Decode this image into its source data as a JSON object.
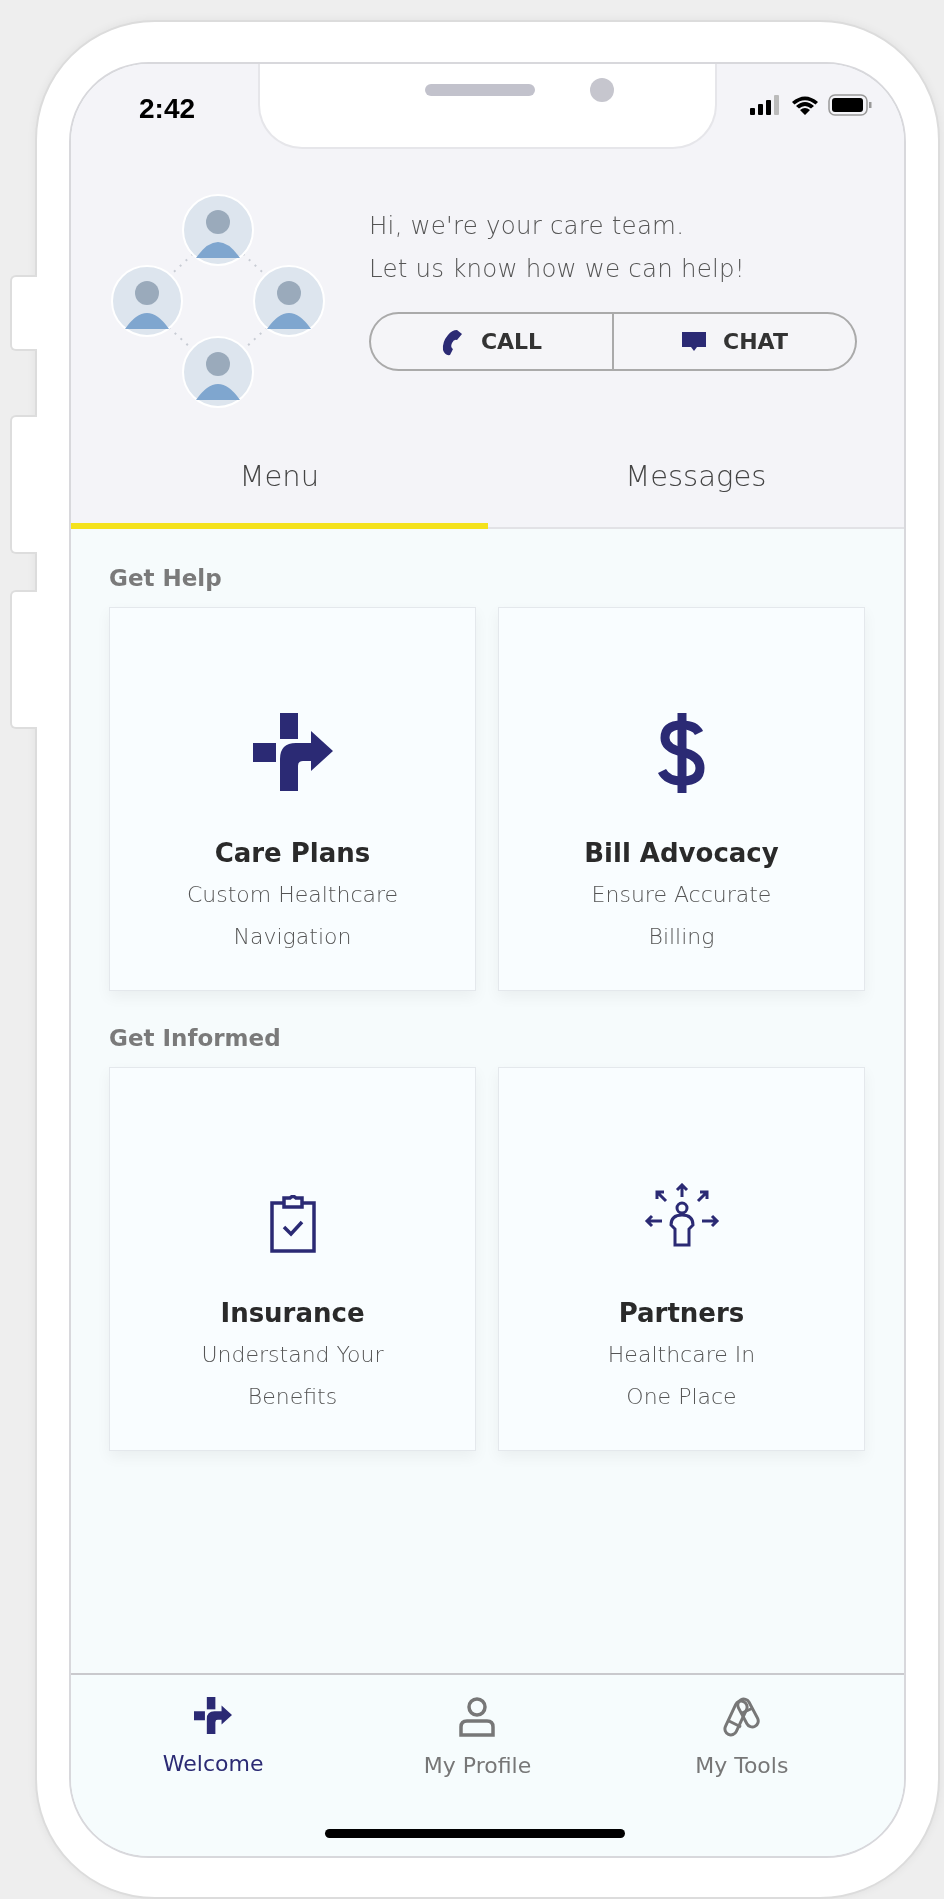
{
  "status_bar": {
    "time": "2:42"
  },
  "care_team": {
    "greeting": "Hi, we're your care team.\nLet us know how we can help!",
    "actions": [
      {
        "kind": "phone",
        "label": "CALL"
      },
      {
        "kind": "chat",
        "label": "CHAT"
      }
    ]
  },
  "tabs": [
    {
      "label": "Menu",
      "selected": true
    },
    {
      "label": "Messages",
      "selected": false
    }
  ],
  "sections": [
    {
      "title": "Get Help",
      "cards": [
        {
          "kind": "care",
          "title": "Care Plans",
          "subtitle": "Custom Healthcare\nNavigation"
        },
        {
          "kind": "billing",
          "title": "Bill Advocacy",
          "subtitle": "Ensure Accurate\nBilling"
        }
      ]
    },
    {
      "title": "Get Informed",
      "cards": [
        {
          "kind": "insurance",
          "title": "Insurance",
          "subtitle": "Understand Your\nBenefits"
        },
        {
          "kind": "partners",
          "title": "Partners",
          "subtitle": "Healthcare In\nOne Place"
        }
      ]
    }
  ],
  "bottom_nav": [
    {
      "kind": "home",
      "label": "Welcome",
      "selected": true
    },
    {
      "kind": "profile",
      "label": "My Profile",
      "selected": false
    },
    {
      "kind": "tools",
      "label": "My Tools",
      "selected": false
    }
  ]
}
